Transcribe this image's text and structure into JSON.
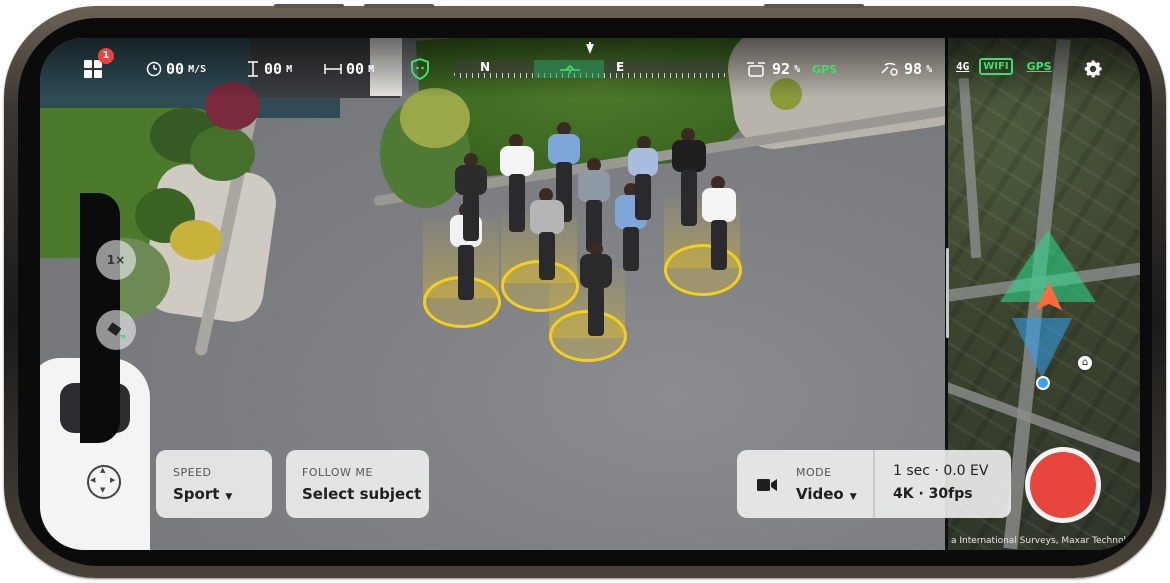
{
  "hud": {
    "notification_count": "1",
    "speed_value": "00",
    "speed_unit": "M/S",
    "height_value": "00",
    "height_unit": "M",
    "distance_value": "00",
    "distance_unit": "M",
    "compass_north": "N",
    "compass_east": "E",
    "drone_battery": "92",
    "drone_battery_unit": "%",
    "drone_gps": "GPS",
    "controller_battery": "98",
    "controller_battery_unit": "%",
    "network": "4G",
    "wifi": "WIFI",
    "controller_gps": "GPS"
  },
  "left_controls": {
    "zoom": "1×"
  },
  "bottom": {
    "speed_caption": "SPEED",
    "speed_value": "Sport",
    "follow_caption": "FOLLOW ME",
    "follow_value": "Select subject",
    "mode_caption": "MODE",
    "mode_value": "Video",
    "exposure": "1 sec · 0.0 EV",
    "resolution": "4K · 30fps"
  },
  "map": {
    "attribution": "a International Surveys, Maxar Technolo"
  },
  "colors": {
    "accent_green": "#3ee06c",
    "record_red": "#e8453c",
    "subject_marker": "#f6cf1a",
    "drone_arrow": "#ff6a3c"
  },
  "icons": [
    "grid-menu-icon",
    "speedometer-icon",
    "height-icon",
    "distance-icon",
    "shield-icon",
    "drone-battery-icon",
    "controller-icon",
    "settings-gear-icon",
    "camera-rotate-icon",
    "joystick-icon",
    "video-camera-icon",
    "home-icon"
  ]
}
